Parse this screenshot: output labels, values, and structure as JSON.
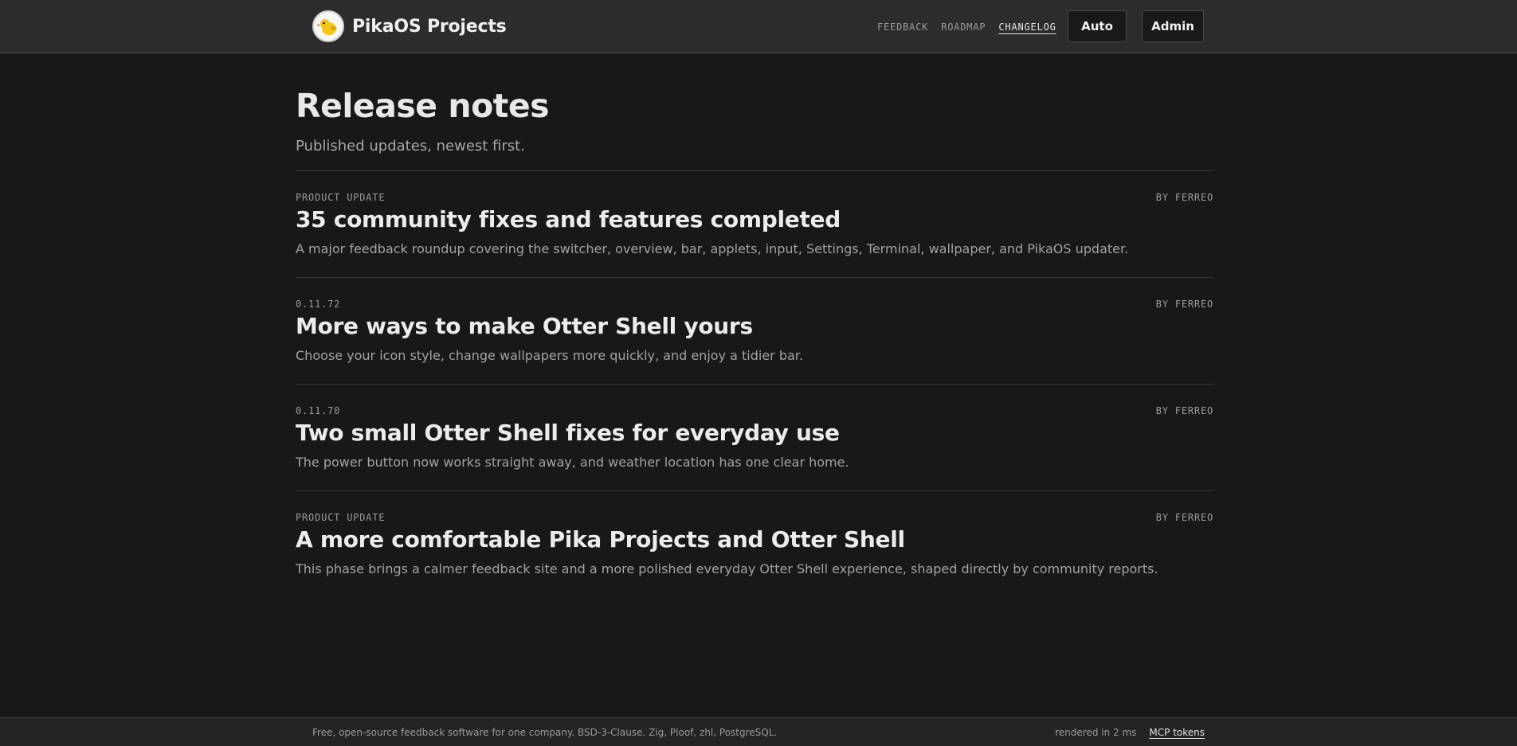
{
  "header": {
    "brand_name": "PikaOS Projects",
    "nav": [
      {
        "label": "FEEDBACK"
      },
      {
        "label": "ROADMAP"
      },
      {
        "label": "CHANGELOG"
      }
    ],
    "theme_button": "Auto",
    "admin_button": "Admin"
  },
  "page": {
    "title": "Release notes",
    "subtitle": "Published updates, newest first."
  },
  "releases": [
    {
      "tag": "PRODUCT UPDATE",
      "author": "BY FERREO",
      "title": "35 community fixes and features completed",
      "summary": "A major feedback roundup covering the switcher, overview, bar, applets, input, Settings, Terminal, wallpaper, and PikaOS updater."
    },
    {
      "tag": "0.11.72",
      "author": "BY FERREO",
      "title": "More ways to make Otter Shell yours",
      "summary": "Choose your icon style, change wallpapers more quickly, and enjoy a tidier bar."
    },
    {
      "tag": "0.11.70",
      "author": "BY FERREO",
      "title": "Two small Otter Shell fixes for everyday use",
      "summary": "The power button now works straight away, and weather location has one clear home."
    },
    {
      "tag": "PRODUCT UPDATE",
      "author": "BY FERREO",
      "title": "A more comfortable Pika Projects and Otter Shell",
      "summary": "This phase brings a calmer feedback site and a more polished everyday Otter Shell experience, shaped directly by community reports."
    }
  ],
  "footer": {
    "text": "Free, open-source feedback software for one company. BSD-3-Clause. Zig, Ploof, zhl, PostgreSQL.",
    "timing": "rendered in 2 ms",
    "link": "MCP tokens"
  },
  "colors": {
    "background": "#181818",
    "header_bg": "#2c2c2c",
    "footer_bg": "#242424"
  }
}
